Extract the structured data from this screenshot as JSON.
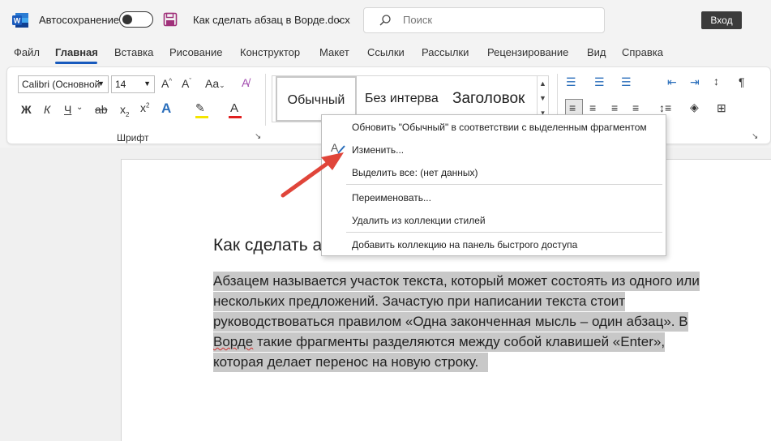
{
  "titlebar": {
    "autosave_label": "Автосохранение",
    "doc_title": "Как сделать абзац в Ворде.docx",
    "search_placeholder": "Поиск",
    "login_label": "Вход"
  },
  "tabs": [
    {
      "label": "Файл"
    },
    {
      "label": "Главная"
    },
    {
      "label": "Вставка"
    },
    {
      "label": "Рисование"
    },
    {
      "label": "Конструктор"
    },
    {
      "label": "Макет"
    },
    {
      "label": "Ссылки"
    },
    {
      "label": "Рассылки"
    },
    {
      "label": "Рецензирование"
    },
    {
      "label": "Вид"
    },
    {
      "label": "Справка"
    }
  ],
  "ribbon": {
    "font_name": "Calibri (Основной",
    "font_size": "14",
    "font_group_label": "Шрифт",
    "styles": [
      "Обычный",
      "Без интерва",
      "Заголовок"
    ]
  },
  "document": {
    "heading": "Как сделать а",
    "paragraph_lines": [
      "Абзацем называется участок текста, который может состоять из одного или",
      "нескольких предложений. Зачастую при написании текста стоит",
      "руководствоваться правилом «Одна законченная мысль – один абзац». В",
      "которая делает перенос на новую строку."
    ],
    "line4_word": "Ворде",
    "line4_rest": " такие фрагменты разделяются между собой клавишей «Enter»,"
  },
  "context_menu": {
    "items": [
      "Обновить \"Обычный\" в соответствии с выделенным фрагментом",
      "Изменить...",
      "Выделить все: (нет данных)",
      "Переименовать...",
      "Удалить из коллекции стилей",
      "Добавить коллекцию на панель быстрого доступа"
    ]
  },
  "colors": {
    "accent": "#185abd",
    "word_blue": "#185abd",
    "save_purple": "#a0307a",
    "arrow_red": "#e0453a",
    "selection_gray": "#c8c8c8"
  }
}
